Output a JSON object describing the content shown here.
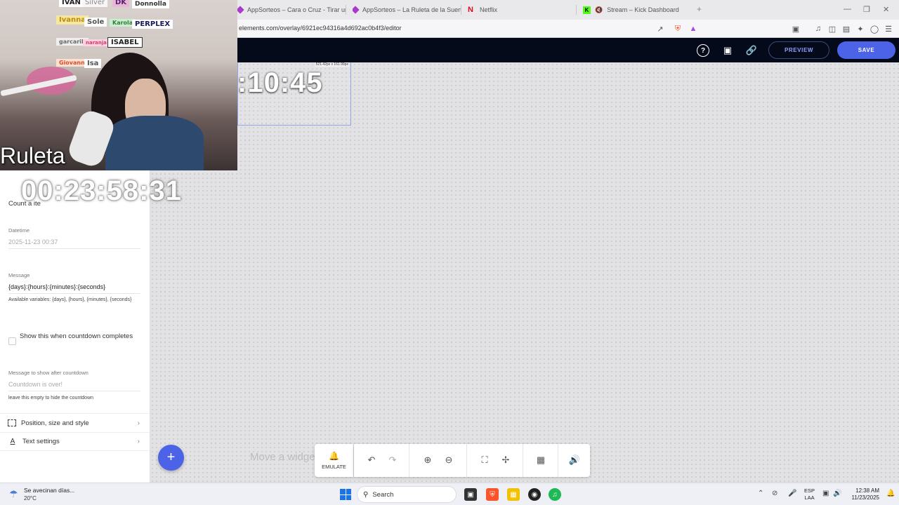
{
  "browser": {
    "tabs": [
      {
        "label": "AppSorteos – Cara o Cruz - Tirar una",
        "color": "#a63cc9"
      },
      {
        "label": "AppSorteos – La Ruleta de la Suerte",
        "color": "#a63cc9"
      },
      {
        "label": "Netflix",
        "color": "#e50914"
      },
      {
        "label": "Stream – Kick Dashboard",
        "color": "#53fc18"
      }
    ],
    "new_tab": "+",
    "url": "elements.com/overlay/6921ec94316a4d692ac0b4f3/editor"
  },
  "toolbar": {
    "preview_label": "PREVIEW",
    "save_label": "SAVE"
  },
  "canvas": {
    "widget_dims": "521.42px x 161.99px",
    "widget_time": ":10:45",
    "move_hint": "Move a widge"
  },
  "webcam": {
    "signs": [
      "IVAN",
      "Silver",
      "DK",
      "Donnolla",
      "Ivanna",
      "Sole",
      "Karola",
      "PERPLEX",
      "garcarib",
      "naranja",
      "ISABEL",
      "Giovanni",
      "Isa"
    ],
    "overlay_title": "Ruleta",
    "overlay_timer": "00:23:58:31"
  },
  "panel": {
    "countdown_title": "Count a ite",
    "datetime_label": "Datetime",
    "datetime_value": "2025-11-23 00:37",
    "message_label": "Message",
    "message_value": "{days}:{hours}:{minutes}:{seconds}",
    "message_help": "Available variables: {days}, {hours}, {minutes}, {seconds}",
    "show_when_complete": "Show this when countdown completes",
    "after_label": "Message to show after countdown",
    "after_placeholder": "Countdown is over!",
    "after_help": "leave this empty to hide the countdown",
    "section_position": "Position, size and style",
    "section_text": "Text settings"
  },
  "bottom_toolbar": {
    "emulate_label": "EMULATE"
  },
  "taskbar": {
    "weather_text": "Se avecinan días...",
    "weather_temp": "20°C",
    "search_label": "Search",
    "lang_top": "ESP",
    "lang_bottom": "LAA",
    "time": "12:38 AM",
    "date": "11/23/2025"
  }
}
